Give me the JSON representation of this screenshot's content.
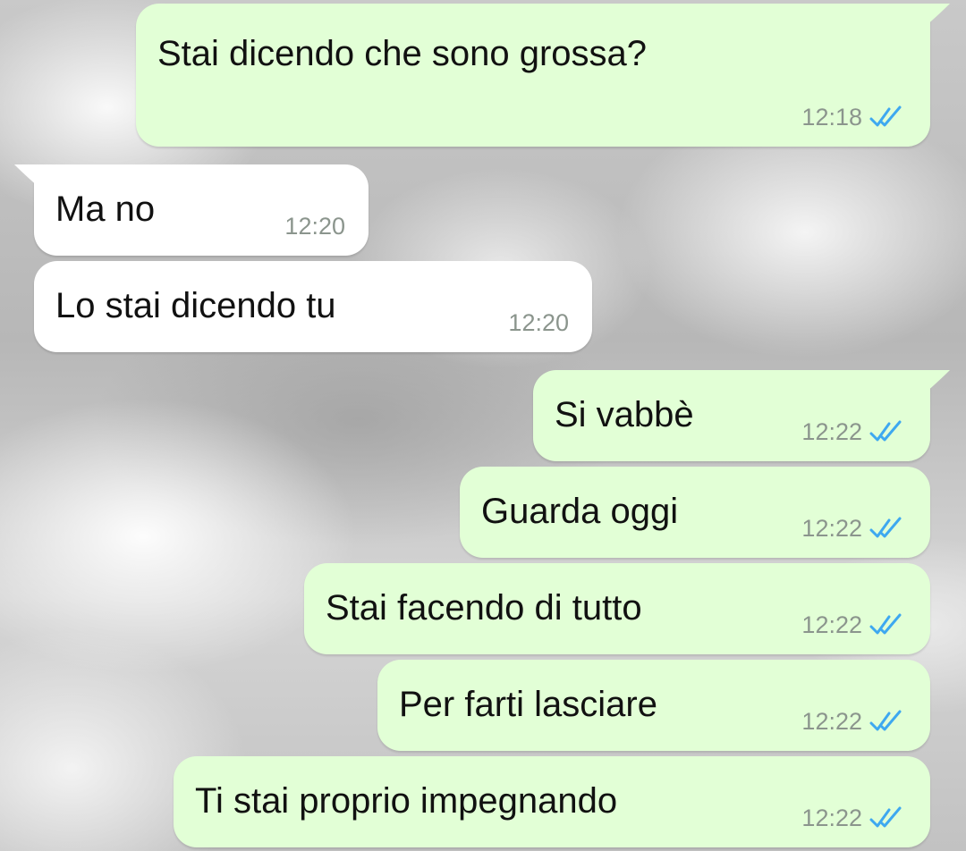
{
  "colors": {
    "outgoing_bubble": "#e2ffd6",
    "incoming_bubble": "#ffffff",
    "read_ticks": "#3ea8f0",
    "timestamp": "#8b958d"
  },
  "messages": [
    {
      "direction": "outgoing",
      "text": "Stai dicendo che sono grossa?",
      "time": "12:18",
      "status": "read"
    },
    {
      "direction": "incoming",
      "text": "Ma no",
      "time": "12:20"
    },
    {
      "direction": "incoming",
      "text": "Lo stai dicendo tu",
      "time": "12:20"
    },
    {
      "direction": "outgoing",
      "text": "Si vabbè",
      "time": "12:22",
      "status": "read"
    },
    {
      "direction": "outgoing",
      "text": "Guarda oggi",
      "time": "12:22",
      "status": "read"
    },
    {
      "direction": "outgoing",
      "text": "Stai facendo di tutto",
      "time": "12:22",
      "status": "read"
    },
    {
      "direction": "outgoing",
      "text": "Per farti lasciare",
      "time": "12:22",
      "status": "read"
    },
    {
      "direction": "outgoing",
      "text": "Ti stai proprio impegnando",
      "time": "12:22",
      "status": "read"
    }
  ],
  "icons": {
    "read_status": "double-check-icon",
    "bubble_tail": "bubble-tail-icon"
  }
}
